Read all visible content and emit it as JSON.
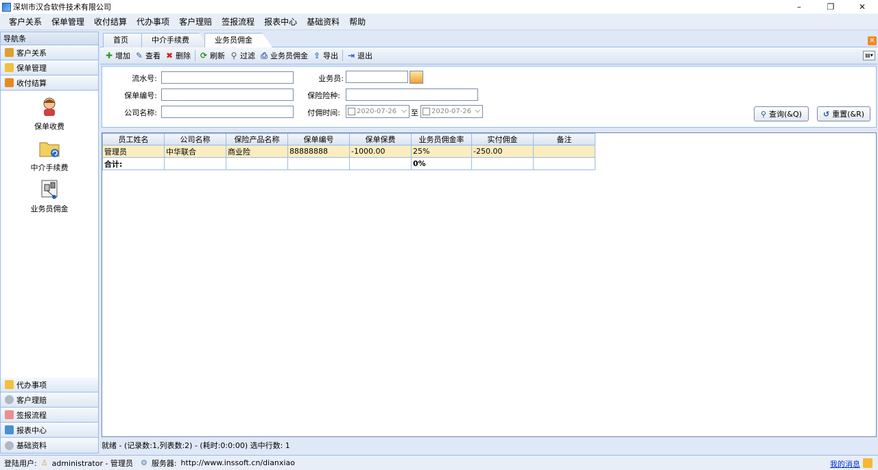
{
  "window": {
    "title": "深圳市汉合软件技术有限公司",
    "min_glyph": "–",
    "max_glyph": "❐",
    "close_glyph": "✕"
  },
  "menu": [
    "客户关系",
    "保单管理",
    "收付结算",
    "代办事项",
    "客户理赔",
    "签报流程",
    "报表中心",
    "基础资料",
    "帮助"
  ],
  "nav": {
    "header": "导航条",
    "top_groups": [
      "客户关系",
      "保单管理",
      "收付结算"
    ],
    "entries": [
      "保单收费",
      "中介手续费",
      "业务员佣金"
    ],
    "bottom_groups": [
      "代办事项",
      "客户理赔",
      "签报流程",
      "报表中心",
      "基础资料"
    ]
  },
  "tabs": [
    "首页",
    "中介手续费",
    "业务员佣金"
  ],
  "toolbar": {
    "add": "增加",
    "view": "查看",
    "delete": "删除",
    "refresh": "刷新",
    "filter": "过滤",
    "agent_commission": "业务员佣金",
    "export": "导出",
    "exit": "退出"
  },
  "filter": {
    "serial_label": "流水号:",
    "serial_value": "",
    "agent_label": "业务员:",
    "agent_value": "",
    "policy_label": "保单编号:",
    "policy_value": "",
    "insurance_label": "保险险种:",
    "insurance_value": "",
    "company_label": "公司名称:",
    "company_value": "",
    "paytime_label": "付佣时间:",
    "date_from": "2020-07-26",
    "date_to_sep": "至",
    "date_to": "2020-07-26",
    "query_btn": "查询(&Q)",
    "reset_btn": "重置(&R)"
  },
  "grid": {
    "columns": [
      "员工姓名",
      "公司名称",
      "保险产品名称",
      "保单编号",
      "保单保费",
      "业务员佣金率",
      "实付佣金",
      "备注"
    ],
    "rows": [
      [
        "管理员",
        "中华联合",
        "商业险",
        "88888888",
        "-1000.00",
        "25%",
        "-250.00",
        ""
      ]
    ],
    "total": [
      "合计:",
      "",
      "",
      "",
      "",
      "0%",
      "",
      ""
    ]
  },
  "status": "就绪 - (记录数:1,列表数:2) - (耗时:0:0:00) 选中行数: 1",
  "footer": {
    "user_label": "登陆用户:",
    "user": "administrator - 管理员",
    "server_label": "服务器:",
    "server": "http://www.inssoft.cn/dianxiao",
    "messages": "我的消息"
  }
}
